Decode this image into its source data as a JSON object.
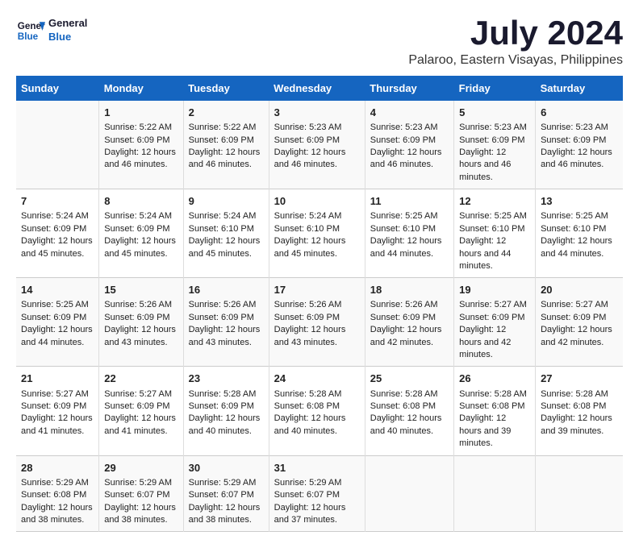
{
  "header": {
    "logo_line1": "General",
    "logo_line2": "Blue",
    "title": "July 2024",
    "subtitle": "Palaroo, Eastern Visayas, Philippines"
  },
  "days_of_week": [
    "Sunday",
    "Monday",
    "Tuesday",
    "Wednesday",
    "Thursday",
    "Friday",
    "Saturday"
  ],
  "weeks": [
    [
      {
        "day": "",
        "sunrise": "",
        "sunset": "",
        "daylight": ""
      },
      {
        "day": "1",
        "sunrise": "Sunrise: 5:22 AM",
        "sunset": "Sunset: 6:09 PM",
        "daylight": "Daylight: 12 hours and 46 minutes."
      },
      {
        "day": "2",
        "sunrise": "Sunrise: 5:22 AM",
        "sunset": "Sunset: 6:09 PM",
        "daylight": "Daylight: 12 hours and 46 minutes."
      },
      {
        "day": "3",
        "sunrise": "Sunrise: 5:23 AM",
        "sunset": "Sunset: 6:09 PM",
        "daylight": "Daylight: 12 hours and 46 minutes."
      },
      {
        "day": "4",
        "sunrise": "Sunrise: 5:23 AM",
        "sunset": "Sunset: 6:09 PM",
        "daylight": "Daylight: 12 hours and 46 minutes."
      },
      {
        "day": "5",
        "sunrise": "Sunrise: 5:23 AM",
        "sunset": "Sunset: 6:09 PM",
        "daylight": "Daylight: 12 hours and 46 minutes."
      },
      {
        "day": "6",
        "sunrise": "Sunrise: 5:23 AM",
        "sunset": "Sunset: 6:09 PM",
        "daylight": "Daylight: 12 hours and 46 minutes."
      }
    ],
    [
      {
        "day": "7",
        "sunrise": "Sunrise: 5:24 AM",
        "sunset": "Sunset: 6:09 PM",
        "daylight": "Daylight: 12 hours and 45 minutes."
      },
      {
        "day": "8",
        "sunrise": "Sunrise: 5:24 AM",
        "sunset": "Sunset: 6:09 PM",
        "daylight": "Daylight: 12 hours and 45 minutes."
      },
      {
        "day": "9",
        "sunrise": "Sunrise: 5:24 AM",
        "sunset": "Sunset: 6:10 PM",
        "daylight": "Daylight: 12 hours and 45 minutes."
      },
      {
        "day": "10",
        "sunrise": "Sunrise: 5:24 AM",
        "sunset": "Sunset: 6:10 PM",
        "daylight": "Daylight: 12 hours and 45 minutes."
      },
      {
        "day": "11",
        "sunrise": "Sunrise: 5:25 AM",
        "sunset": "Sunset: 6:10 PM",
        "daylight": "Daylight: 12 hours and 44 minutes."
      },
      {
        "day": "12",
        "sunrise": "Sunrise: 5:25 AM",
        "sunset": "Sunset: 6:10 PM",
        "daylight": "Daylight: 12 hours and 44 minutes."
      },
      {
        "day": "13",
        "sunrise": "Sunrise: 5:25 AM",
        "sunset": "Sunset: 6:10 PM",
        "daylight": "Daylight: 12 hours and 44 minutes."
      }
    ],
    [
      {
        "day": "14",
        "sunrise": "Sunrise: 5:25 AM",
        "sunset": "Sunset: 6:09 PM",
        "daylight": "Daylight: 12 hours and 44 minutes."
      },
      {
        "day": "15",
        "sunrise": "Sunrise: 5:26 AM",
        "sunset": "Sunset: 6:09 PM",
        "daylight": "Daylight: 12 hours and 43 minutes."
      },
      {
        "day": "16",
        "sunrise": "Sunrise: 5:26 AM",
        "sunset": "Sunset: 6:09 PM",
        "daylight": "Daylight: 12 hours and 43 minutes."
      },
      {
        "day": "17",
        "sunrise": "Sunrise: 5:26 AM",
        "sunset": "Sunset: 6:09 PM",
        "daylight": "Daylight: 12 hours and 43 minutes."
      },
      {
        "day": "18",
        "sunrise": "Sunrise: 5:26 AM",
        "sunset": "Sunset: 6:09 PM",
        "daylight": "Daylight: 12 hours and 42 minutes."
      },
      {
        "day": "19",
        "sunrise": "Sunrise: 5:27 AM",
        "sunset": "Sunset: 6:09 PM",
        "daylight": "Daylight: 12 hours and 42 minutes."
      },
      {
        "day": "20",
        "sunrise": "Sunrise: 5:27 AM",
        "sunset": "Sunset: 6:09 PM",
        "daylight": "Daylight: 12 hours and 42 minutes."
      }
    ],
    [
      {
        "day": "21",
        "sunrise": "Sunrise: 5:27 AM",
        "sunset": "Sunset: 6:09 PM",
        "daylight": "Daylight: 12 hours and 41 minutes."
      },
      {
        "day": "22",
        "sunrise": "Sunrise: 5:27 AM",
        "sunset": "Sunset: 6:09 PM",
        "daylight": "Daylight: 12 hours and 41 minutes."
      },
      {
        "day": "23",
        "sunrise": "Sunrise: 5:28 AM",
        "sunset": "Sunset: 6:09 PM",
        "daylight": "Daylight: 12 hours and 40 minutes."
      },
      {
        "day": "24",
        "sunrise": "Sunrise: 5:28 AM",
        "sunset": "Sunset: 6:08 PM",
        "daylight": "Daylight: 12 hours and 40 minutes."
      },
      {
        "day": "25",
        "sunrise": "Sunrise: 5:28 AM",
        "sunset": "Sunset: 6:08 PM",
        "daylight": "Daylight: 12 hours and 40 minutes."
      },
      {
        "day": "26",
        "sunrise": "Sunrise: 5:28 AM",
        "sunset": "Sunset: 6:08 PM",
        "daylight": "Daylight: 12 hours and 39 minutes."
      },
      {
        "day": "27",
        "sunrise": "Sunrise: 5:28 AM",
        "sunset": "Sunset: 6:08 PM",
        "daylight": "Daylight: 12 hours and 39 minutes."
      }
    ],
    [
      {
        "day": "28",
        "sunrise": "Sunrise: 5:29 AM",
        "sunset": "Sunset: 6:08 PM",
        "daylight": "Daylight: 12 hours and 38 minutes."
      },
      {
        "day": "29",
        "sunrise": "Sunrise: 5:29 AM",
        "sunset": "Sunset: 6:07 PM",
        "daylight": "Daylight: 12 hours and 38 minutes."
      },
      {
        "day": "30",
        "sunrise": "Sunrise: 5:29 AM",
        "sunset": "Sunset: 6:07 PM",
        "daylight": "Daylight: 12 hours and 38 minutes."
      },
      {
        "day": "31",
        "sunrise": "Sunrise: 5:29 AM",
        "sunset": "Sunset: 6:07 PM",
        "daylight": "Daylight: 12 hours and 37 minutes."
      },
      {
        "day": "",
        "sunrise": "",
        "sunset": "",
        "daylight": ""
      },
      {
        "day": "",
        "sunrise": "",
        "sunset": "",
        "daylight": ""
      },
      {
        "day": "",
        "sunrise": "",
        "sunset": "",
        "daylight": ""
      }
    ]
  ]
}
